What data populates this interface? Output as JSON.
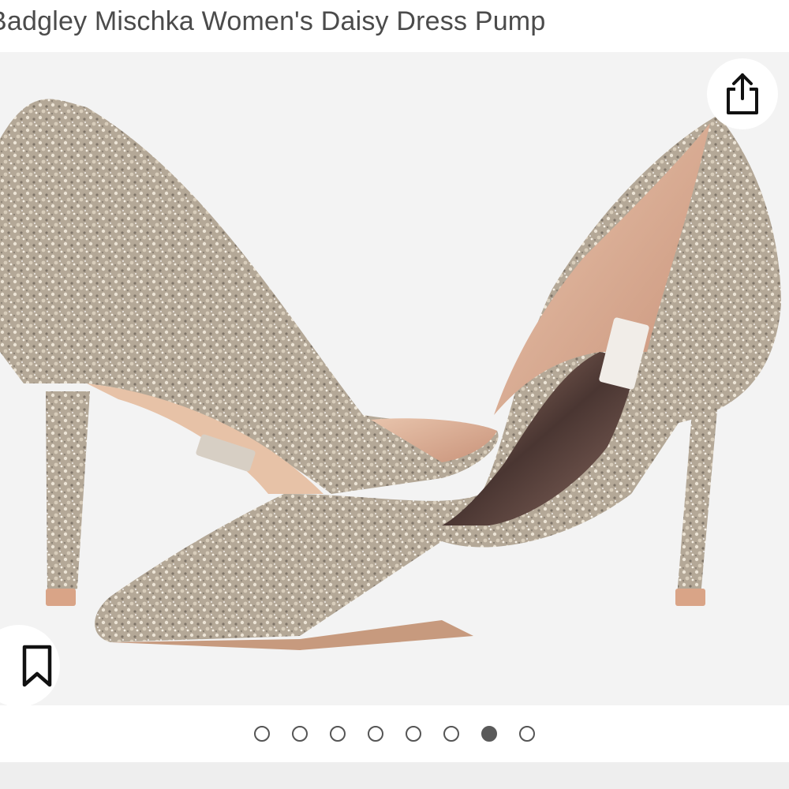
{
  "product": {
    "title": "Badgley Mischka Women's Daisy Dress Pump",
    "image_alt": "Glitter pointed-toe d'Orsay pumps"
  },
  "actions": {
    "share_icon": "share-icon",
    "save_icon": "bookmark-icon"
  },
  "gallery": {
    "image_count": 8,
    "active_index": 6
  },
  "colors": {
    "background": "#f3f3f3",
    "dot_active": "#5a5a5a",
    "title_text": "#4b4b4b"
  }
}
